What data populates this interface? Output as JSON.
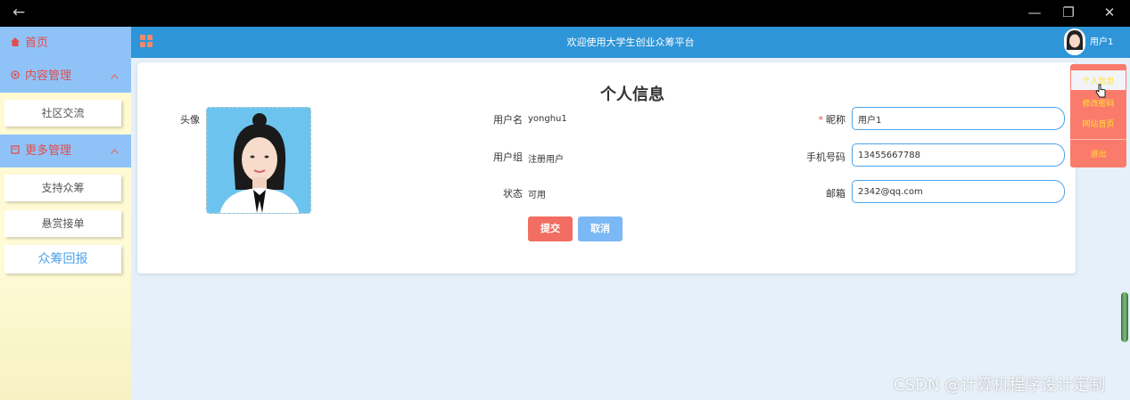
{
  "window": {
    "back_glyph": "←",
    "minimize_glyph": "—",
    "restore_glyph": "❐",
    "close_glyph": "✕"
  },
  "sidebar": {
    "home": "首页",
    "content_mgmt": "内容管理",
    "community": "社区交流",
    "more_mgmt": "更多管理",
    "items": [
      "支持众筹",
      "悬赏接单",
      "众筹回报"
    ]
  },
  "header": {
    "title": "欢迎使用大学生创业众筹平台",
    "username": "用户1"
  },
  "profile": {
    "title": "个人信息",
    "avatar_label": "头像",
    "username_label": "用户名",
    "username_value": "yonghu1",
    "group_label": "用户组",
    "group_value": "注册用户",
    "status_label": "状态",
    "status_value": "可用",
    "nickname_required": "*",
    "nickname_label": "昵称",
    "nickname_value": "用户1",
    "phone_label": "手机号码",
    "phone_value": "13455667788",
    "email_label": "邮箱",
    "email_value": "2342@qq.com",
    "submit_label": "提交",
    "cancel_label": "取消"
  },
  "dropdown": {
    "items": [
      "个人信息",
      "修改密码",
      "网站首页",
      "退出"
    ]
  },
  "watermark": "CSDN @计算机程序设计定制",
  "colors": {
    "header_blue": "#2e95d9",
    "menu_blue": "#8fc3f7",
    "submit_red": "#f26e62",
    "cancel_blue": "#7cb8f5",
    "dropdown_red": "#fa7b6b",
    "dropdown_text": "#ffe233",
    "sidebar_bg": "#fff9d0"
  }
}
